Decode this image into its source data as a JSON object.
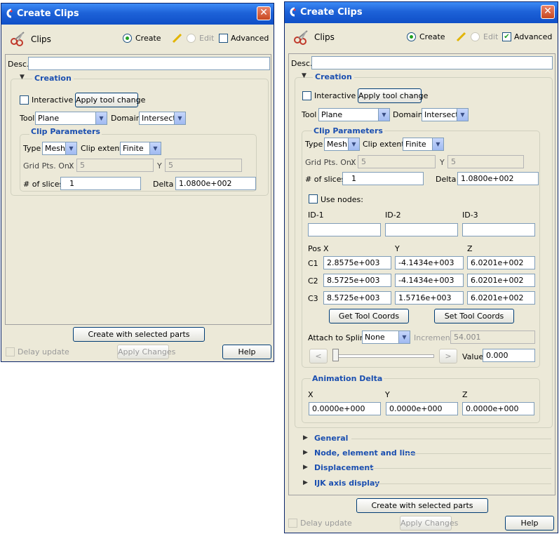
{
  "left": {
    "title": "Create Clips",
    "close": "✕",
    "clips_label": "Clips",
    "mode_create": "Create",
    "mode_edit": "Edit",
    "advanced": "Advanced",
    "desc_label": "Desc.",
    "desc_value": "",
    "creation": "Creation",
    "interactive": "Interactive",
    "apply_tool_change": "Apply tool change",
    "tool_label": "Tool",
    "tool_value": "Plane",
    "domain_label": "Domain",
    "domain_value": "Intersect",
    "clip_params": "Clip Parameters",
    "type_label": "Type",
    "type_value": "Mesh",
    "clip_extent_label": "Clip extent",
    "clip_extent_value": "Finite",
    "grid_pts_label": "Grid Pts. On:",
    "x_label": "X",
    "x_value": "5",
    "y_label": "Y",
    "y_value": "5",
    "slices_label": "# of slices",
    "slices_value": "1",
    "delta_label": "Delta",
    "delta_value": "1.0800e+002",
    "create_with_parts": "Create with selected parts",
    "delay_update": "Delay update",
    "apply_changes": "Apply Changes",
    "help": "Help"
  },
  "right": {
    "title": "Create Clips",
    "close": "✕",
    "clips_label": "Clips",
    "mode_create": "Create",
    "mode_edit": "Edit",
    "advanced": "Advanced",
    "advanced_check": "✔",
    "desc_label": "Desc.",
    "desc_value": "",
    "creation": "Creation",
    "interactive": "Interactive",
    "apply_tool_change": "Apply tool change",
    "tool_label": "Tool",
    "tool_value": "Plane",
    "domain_label": "Domain",
    "domain_value": "Intersect",
    "clip_params": "Clip Parameters",
    "type_label": "Type",
    "type_value": "Mesh",
    "clip_extent_label": "Clip extent",
    "clip_extent_value": "Finite",
    "grid_pts_label": "Grid Pts. On:",
    "x_label": "X",
    "x_value": "5",
    "y_label": "Y",
    "y_value": "5",
    "slices_label": "# of slices",
    "slices_value": "1",
    "delta_label": "Delta",
    "delta_value": "1.0800e+002",
    "use_nodes": "Use nodes:",
    "id1": "ID-1",
    "id2": "ID-2",
    "id3": "ID-3",
    "pos_label": "Pos",
    "col_x": "X",
    "col_y": "Y",
    "col_z": "Z",
    "c1_label": "C1",
    "c1": [
      "2.8575e+003",
      "-4.1434e+003",
      "6.0201e+002"
    ],
    "c2_label": "C2",
    "c2": [
      "8.5725e+003",
      "-4.1434e+003",
      "6.0201e+002"
    ],
    "c3_label": "C3",
    "c3": [
      "8.5725e+003",
      "1.5716e+003",
      "6.0201e+002"
    ],
    "get_tool_coords": "Get Tool Coords",
    "set_tool_coords": "Set Tool Coords",
    "attach_label": "Attach to Spline",
    "attach_value": "None",
    "increment_label": "Increment",
    "increment_value": "54.001",
    "prev": "<",
    "next": ">",
    "value_label": "Value",
    "value_value": "0.000",
    "anim_delta": "Animation Delta",
    "ax": "X",
    "ay": "Y",
    "az": "Z",
    "ax_value": "0.0000e+000",
    "ay_value": "0.0000e+000",
    "az_value": "0.0000e+000",
    "general": "General",
    "node_elem_line": "Node, element and line",
    "displacement": "Displacement",
    "ijk": "IJK axis display",
    "create_with_parts": "Create with selected parts",
    "delay_update": "Delay update",
    "apply_changes": "Apply Changes",
    "help": "Help"
  }
}
